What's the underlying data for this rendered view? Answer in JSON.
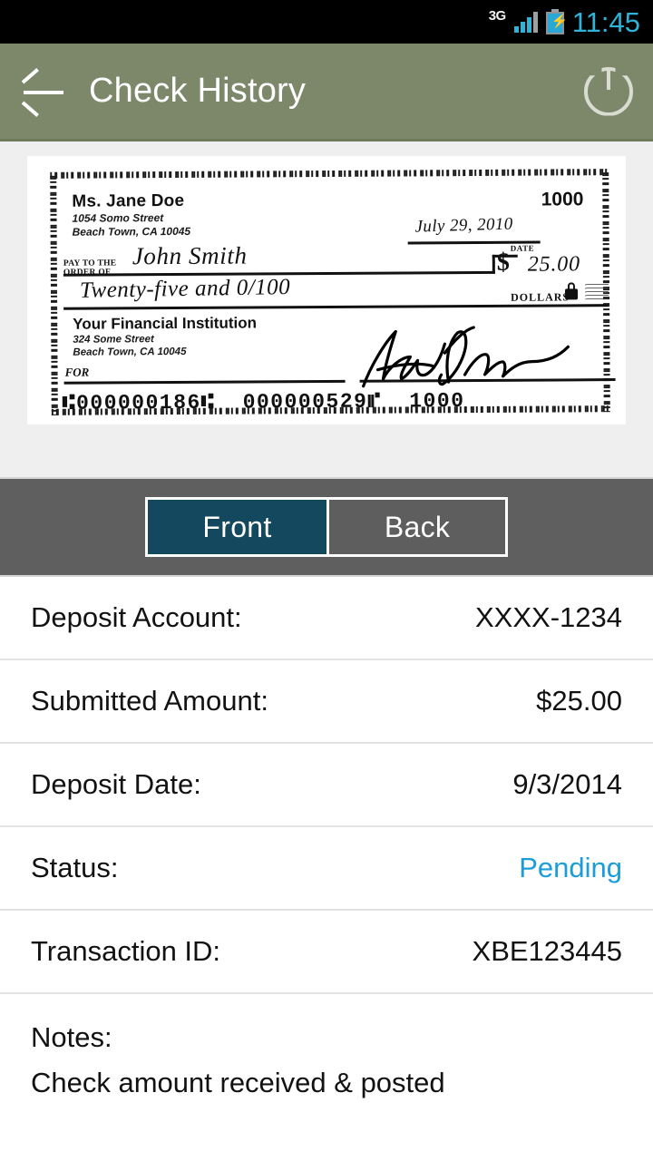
{
  "statusbar": {
    "network": "3G",
    "time": "11:45",
    "battery_icon": "battery-charging-icon",
    "signal_icon": "signal-bars-icon"
  },
  "appbar": {
    "title": "Check History",
    "back_icon": "back-arrow-icon",
    "power_icon": "power-icon"
  },
  "check": {
    "payer_name": "Ms. Jane Doe",
    "payer_address_line1": "1054 Somo Street",
    "payer_address_line2": "Beach Town, CA 10045",
    "check_number": "1000",
    "date": "July 29, 2010",
    "date_label": "DATE",
    "pay_to_label": "PAY TO THE\nORDER OF",
    "payee": "John Smith",
    "dollar_sign": "$",
    "amount_numeric": "25.00",
    "amount_words": "Twenty-five and 0/100",
    "dollars_label": "DOLLARS",
    "bank_name": "Your Financial Institution",
    "bank_address_line1": "324 Some Street",
    "bank_address_line2": "Beach Town, CA 10045",
    "for_label": "FOR",
    "micr_line": "⑆000000186⑆  000000529⑈  1000",
    "lock_icon": "lock-icon",
    "signature_alt": "handwritten-signature"
  },
  "toggle": {
    "front_label": "Front",
    "back_label": "Back",
    "selected": "Front",
    "active_color": "#14485e"
  },
  "details": {
    "rows": [
      {
        "label": "Deposit Account:",
        "value": "XXXX-1234",
        "accent": false
      },
      {
        "label": "Submitted Amount:",
        "value": "$25.00",
        "accent": false
      },
      {
        "label": "Deposit Date:",
        "value": "9/3/2014",
        "accent": false
      },
      {
        "label": "Status:",
        "value": "Pending",
        "accent": true
      },
      {
        "label": "Transaction ID:",
        "value": "XBE123445",
        "accent": false
      }
    ],
    "status_color": "#1b9dd9"
  },
  "notes": {
    "label": "Notes:",
    "text": "Check amount received & posted"
  }
}
